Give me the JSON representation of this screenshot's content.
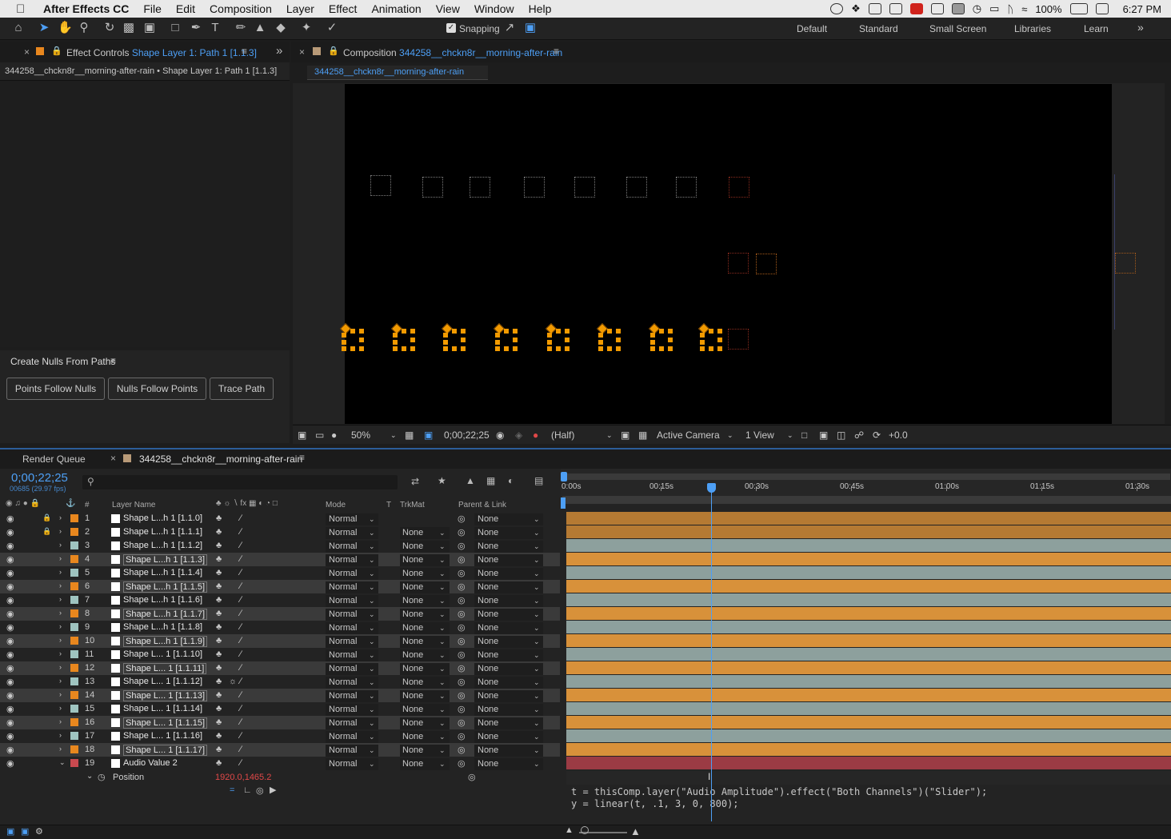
{
  "menubar": {
    "app": "After Effects CC",
    "items": [
      "File",
      "Edit",
      "Composition",
      "Layer",
      "Effect",
      "Animation",
      "View",
      "Window",
      "Help"
    ],
    "battery": "100%",
    "time": "6:27 PM"
  },
  "toolbar": {
    "snapping_label": "Snapping",
    "workspaces": [
      "Default",
      "Standard",
      "Small Screen",
      "Libraries",
      "Learn"
    ]
  },
  "effect_controls": {
    "tab_prefix": "Effect Controls",
    "tab_target": "Shape Layer 1: Path 1 [1.1.3]",
    "breadcrumb": "344258__chckn8r__morning-after-rain • Shape Layer 1: Path 1 [1.1.3]"
  },
  "nulls_panel": {
    "title": "Create Nulls From Paths",
    "buttons": [
      "Points Follow Nulls",
      "Nulls Follow Points",
      "Trace Path"
    ]
  },
  "composition": {
    "tab_prefix": "Composition",
    "name": "344258__chckn8r__morning-after-rain",
    "sub_tab": "344258__chckn8r__morning-after-rain"
  },
  "viewer_footer": {
    "zoom": "50%",
    "timecode": "0;00;22;25",
    "resolution": "(Half)",
    "camera": "Active Camera",
    "views": "1 View",
    "exposure": "+0.0"
  },
  "timeline": {
    "render_queue_tab": "Render Queue",
    "comp_tab": "344258__chckn8r__morning-after-rain",
    "current_time": "0;00;22;25",
    "frame_info": "00685 (29.97 fps)",
    "columns": {
      "num": "#",
      "layer_name": "Layer Name",
      "mode": "Mode",
      "t": "T",
      "trkmat": "TrkMat",
      "parent": "Parent & Link"
    },
    "ruler": [
      "0:00s",
      "00:15s",
      "00:30s",
      "00:45s",
      "01:00s",
      "01:15s",
      "01:30s"
    ],
    "layers": [
      {
        "num": "1",
        "name": "Shape L...h 1 [1.1.0]",
        "mode": "Normal",
        "trkmat": "",
        "parent": "None",
        "color": "#e8871e"
      },
      {
        "num": "2",
        "name": "Shape L...h 1 [1.1.1]",
        "mode": "Normal",
        "trkmat": "None",
        "parent": "None",
        "color": "#e8871e"
      },
      {
        "num": "3",
        "name": "Shape L...h 1 [1.1.2]",
        "mode": "Normal",
        "trkmat": "None",
        "parent": "None",
        "color": "#9fc4c0"
      },
      {
        "num": "4",
        "name": "Shape L...h 1 [1.1.3]",
        "mode": "Normal",
        "trkmat": "None",
        "parent": "None",
        "color": "#e8871e"
      },
      {
        "num": "5",
        "name": "Shape L...h 1 [1.1.4]",
        "mode": "Normal",
        "trkmat": "None",
        "parent": "None",
        "color": "#9fc4c0"
      },
      {
        "num": "6",
        "name": "Shape L...h 1 [1.1.5]",
        "mode": "Normal",
        "trkmat": "None",
        "parent": "None",
        "color": "#e8871e"
      },
      {
        "num": "7",
        "name": "Shape L...h 1 [1.1.6]",
        "mode": "Normal",
        "trkmat": "None",
        "parent": "None",
        "color": "#9fc4c0"
      },
      {
        "num": "8",
        "name": "Shape L...h 1 [1.1.7]",
        "mode": "Normal",
        "trkmat": "None",
        "parent": "None",
        "color": "#e8871e"
      },
      {
        "num": "9",
        "name": "Shape L...h 1 [1.1.8]",
        "mode": "Normal",
        "trkmat": "None",
        "parent": "None",
        "color": "#9fc4c0"
      },
      {
        "num": "10",
        "name": "Shape L...h 1 [1.1.9]",
        "mode": "Normal",
        "trkmat": "None",
        "parent": "None",
        "color": "#e8871e"
      },
      {
        "num": "11",
        "name": "Shape L... 1 [1.1.10]",
        "mode": "Normal",
        "trkmat": "None",
        "parent": "None",
        "color": "#9fc4c0"
      },
      {
        "num": "12",
        "name": "Shape L... 1 [1.1.11]",
        "mode": "Normal",
        "trkmat": "None",
        "parent": "None",
        "color": "#e8871e"
      },
      {
        "num": "13",
        "name": "Shape L... 1 [1.1.12]",
        "mode": "Normal",
        "trkmat": "None",
        "parent": "None",
        "color": "#9fc4c0"
      },
      {
        "num": "14",
        "name": "Shape L... 1 [1.1.13]",
        "mode": "Normal",
        "trkmat": "None",
        "parent": "None",
        "color": "#e8871e"
      },
      {
        "num": "15",
        "name": "Shape L... 1 [1.1.14]",
        "mode": "Normal",
        "trkmat": "None",
        "parent": "None",
        "color": "#9fc4c0"
      },
      {
        "num": "16",
        "name": "Shape L... 1 [1.1.15]",
        "mode": "Normal",
        "trkmat": "None",
        "parent": "None",
        "color": "#e8871e"
      },
      {
        "num": "17",
        "name": "Shape L... 1 [1.1.16]",
        "mode": "Normal",
        "trkmat": "None",
        "parent": "None",
        "color": "#9fc4c0"
      },
      {
        "num": "18",
        "name": "Shape L... 1 [1.1.17]",
        "mode": "Normal",
        "trkmat": "None",
        "parent": "None",
        "color": "#e8871e"
      },
      {
        "num": "19",
        "name": "Audio Value 2",
        "mode": "Normal",
        "trkmat": "None",
        "parent": "None",
        "color": "#c8494f"
      }
    ],
    "property": {
      "name": "Position",
      "value": "1920.0,1465.2"
    },
    "expression": [
      "t = thisComp.layer(\"Audio Amplitude\").effect(\"Both Channels\")(\"Slider\");",
      "y = linear(t, .1, 3, 0, 800);"
    ]
  }
}
